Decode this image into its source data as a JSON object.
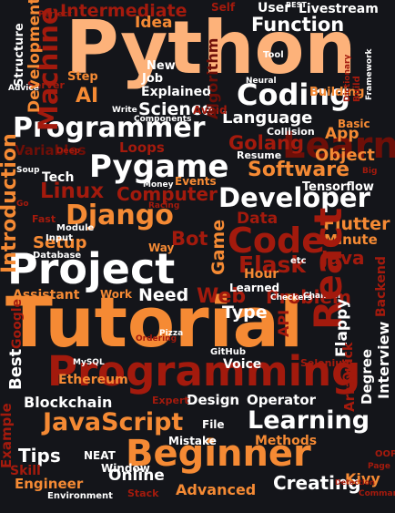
{
  "image": {
    "type": "word cloud",
    "background": "#14151a",
    "palette": {
      "white": "#ffffff",
      "orange": "#f58a34",
      "peach": "#fdb27a",
      "red": "#a31a0d",
      "dark_red": "#6e0f08",
      "mid_red": "#c8350e"
    }
  },
  "words": [
    {
      "text": "Tutorial",
      "color": "orange"
    },
    {
      "text": "Python",
      "color": "peach"
    },
    {
      "text": "Programming",
      "color": "red"
    },
    {
      "text": "Project",
      "color": "white"
    },
    {
      "text": "Beginner",
      "color": "orange"
    },
    {
      "text": "Coding",
      "color": "white"
    },
    {
      "text": "Programmer",
      "color": "white"
    },
    {
      "text": "Pygame",
      "color": "white"
    },
    {
      "text": "Developer",
      "color": "white"
    },
    {
      "text": "Django",
      "color": "orange"
    },
    {
      "text": "JavaScript",
      "color": "orange"
    },
    {
      "text": "Learning",
      "color": "white"
    },
    {
      "text": "Code",
      "color": "red"
    },
    {
      "text": "React",
      "color": "red"
    },
    {
      "text": "Learn",
      "color": "dark_red"
    },
    {
      "text": "Machine",
      "color": "red"
    },
    {
      "text": "Introduction",
      "color": "orange"
    },
    {
      "text": "Software",
      "color": "orange"
    },
    {
      "text": "Function",
      "color": "white"
    },
    {
      "text": "Intermediate",
      "color": "red"
    },
    {
      "text": "Linux",
      "color": "red"
    },
    {
      "text": "Computer",
      "color": "red"
    },
    {
      "text": "Golang",
      "color": "red"
    },
    {
      "text": "Science",
      "color": "white"
    },
    {
      "text": "Language",
      "color": "white"
    },
    {
      "text": "Game",
      "color": "orange"
    },
    {
      "text": "Flutter",
      "color": "orange"
    },
    {
      "text": "Java",
      "color": "red"
    },
    {
      "text": "Data",
      "color": "red"
    },
    {
      "text": "Flask",
      "color": "red"
    },
    {
      "text": "Web",
      "color": "red"
    },
    {
      "text": "Bot",
      "color": "red"
    },
    {
      "text": "Setup",
      "color": "orange"
    },
    {
      "text": "Need",
      "color": "white"
    },
    {
      "text": "Type",
      "color": "white"
    },
    {
      "text": "Tips",
      "color": "white"
    },
    {
      "text": "Creating",
      "color": "white"
    },
    {
      "text": "Blockchain",
      "color": "white"
    },
    {
      "text": "Design",
      "color": "white"
    },
    {
      "text": "Operator",
      "color": "white"
    },
    {
      "text": "Online",
      "color": "white"
    },
    {
      "text": "Advanced",
      "color": "orange"
    },
    {
      "text": "Methods",
      "color": "orange"
    },
    {
      "text": "Engineer",
      "color": "orange"
    },
    {
      "text": "Ethereum",
      "color": "orange"
    },
    {
      "text": "Assistant",
      "color": "orange"
    },
    {
      "text": "Development",
      "color": "orange"
    },
    {
      "text": "AI",
      "color": "orange"
    },
    {
      "text": "Idea",
      "color": "orange"
    },
    {
      "text": "Object",
      "color": "orange"
    },
    {
      "text": "App",
      "color": "orange"
    },
    {
      "text": "Livestream",
      "color": "white"
    },
    {
      "text": "Hour",
      "color": "orange"
    },
    {
      "text": "Minute",
      "color": "orange"
    },
    {
      "text": "Interview",
      "color": "white"
    },
    {
      "text": "Flappy",
      "color": "white"
    },
    {
      "text": "Voice",
      "color": "white"
    },
    {
      "text": "Degree",
      "color": "white"
    },
    {
      "text": "Kivy",
      "color": "orange"
    },
    {
      "text": "Backend",
      "color": "red"
    },
    {
      "text": "Quick",
      "color": "red"
    },
    {
      "text": "Array",
      "color": "red"
    },
    {
      "text": "API",
      "color": "red"
    },
    {
      "text": "Problem",
      "color": "red"
    },
    {
      "text": "Loops",
      "color": "red"
    },
    {
      "text": "Variables",
      "color": "dark_red"
    },
    {
      "text": "Algorithm",
      "color": "dark_red"
    },
    {
      "text": "Skill",
      "color": "red"
    },
    {
      "text": "Example",
      "color": "red"
    },
    {
      "text": "Google",
      "color": "red"
    },
    {
      "text": "Best",
      "color": "white"
    },
    {
      "text": "Mistake",
      "color": "white"
    },
    {
      "text": "Window",
      "color": "white"
    },
    {
      "text": "File",
      "color": "white"
    },
    {
      "text": "NEAT",
      "color": "white"
    },
    {
      "text": "Tech",
      "color": "white"
    },
    {
      "text": "Explained",
      "color": "white"
    },
    {
      "text": "Tensorflow",
      "color": "white"
    },
    {
      "text": "Learned",
      "color": "white"
    },
    {
      "text": "Resume",
      "color": "white"
    },
    {
      "text": "Collision",
      "color": "white"
    },
    {
      "text": "New",
      "color": "white"
    },
    {
      "text": "Job",
      "color": "white"
    },
    {
      "text": "Step",
      "color": "orange"
    },
    {
      "text": "Structure",
      "color": "white"
    },
    {
      "text": "Building",
      "color": "orange"
    },
    {
      "text": "Basic",
      "color": "orange"
    },
    {
      "text": "Events",
      "color": "orange"
    },
    {
      "text": "Way",
      "color": "orange"
    },
    {
      "text": "Work",
      "color": "orange"
    },
    {
      "text": "Input",
      "color": "white"
    },
    {
      "text": "Module",
      "color": "white"
    },
    {
      "text": "Database",
      "color": "white"
    },
    {
      "text": "GitHub",
      "color": "white"
    },
    {
      "text": "Stack",
      "color": "red"
    },
    {
      "text": "Environment",
      "color": "white"
    },
    {
      "text": "Expert",
      "color": "red"
    },
    {
      "text": "Server",
      "color": "red"
    },
    {
      "text": "Fast",
      "color": "red"
    },
    {
      "text": "User",
      "color": "white"
    },
    {
      "text": "Self",
      "color": "red"
    },
    {
      "text": "Tool",
      "color": "white"
    },
    {
      "text": "Neural",
      "color": "white"
    },
    {
      "text": "Build",
      "color": "red"
    },
    {
      "text": "Avoid",
      "color": "red"
    },
    {
      "text": "Selenium",
      "color": "red"
    },
    {
      "text": "Command",
      "color": "red"
    },
    {
      "text": "etc",
      "color": "white"
    },
    {
      "text": "Pizza",
      "color": "white"
    },
    {
      "text": "MySQL",
      "color": "white"
    },
    {
      "text": "Checkers",
      "color": "white"
    },
    {
      "text": "Channel",
      "color": "white"
    },
    {
      "text": "Components",
      "color": "white"
    },
    {
      "text": "Write",
      "color": "white"
    },
    {
      "text": "Money",
      "color": "white"
    },
    {
      "text": "Racing",
      "color": "red"
    },
    {
      "text": "Deep",
      "color": "red"
    },
    {
      "text": "Ordering",
      "color": "red"
    },
    {
      "text": "Perfect",
      "color": "red"
    },
    {
      "text": "Advice",
      "color": "white"
    },
    {
      "text": "Soup",
      "color": "white"
    },
    {
      "text": "Big",
      "color": "red"
    },
    {
      "text": "BEST",
      "color": "white"
    },
    {
      "text": "Framework",
      "color": "white"
    },
    {
      "text": "Detection",
      "color": "red"
    },
    {
      "text": "OOP",
      "color": "red"
    },
    {
      "text": "Page",
      "color": "red"
    },
    {
      "text": "Dictionary",
      "color": "red"
    },
    {
      "text": "Go",
      "color": "red"
    }
  ]
}
